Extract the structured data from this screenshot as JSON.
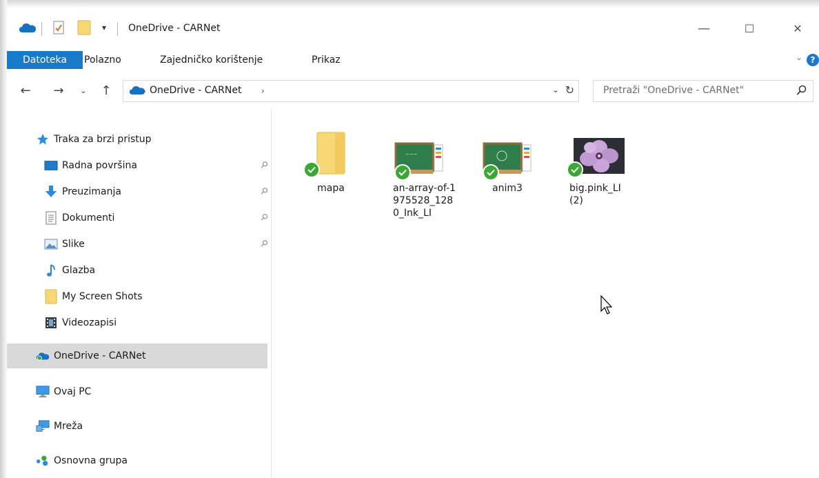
{
  "titlebar": {
    "title": "OneDrive - CARNet",
    "dropdown_glyph": "▾"
  },
  "window_controls": {
    "minimize": "—",
    "maximize": "☐",
    "close": "✕"
  },
  "ribbon": {
    "tabs": [
      "Datoteka",
      "Polazno",
      "Zajedničko korištenje",
      "Prikaz"
    ],
    "help": "?"
  },
  "address": {
    "path": [
      "OneDrive - CARNet"
    ],
    "search_placeholder": "Pretraži \"OneDrive - CARNet\""
  },
  "nav": {
    "quick_access": "Traka za brzi pristup",
    "quick_items": [
      {
        "label": "Radna površina",
        "icon": "desktop-icon",
        "pinned": true
      },
      {
        "label": "Preuzimanja",
        "icon": "downloads-icon",
        "pinned": true
      },
      {
        "label": "Dokumenti",
        "icon": "documents-icon",
        "pinned": true
      },
      {
        "label": "Slike",
        "icon": "pictures-icon",
        "pinned": true
      },
      {
        "label": "Glazba",
        "icon": "music-icon",
        "pinned": false
      },
      {
        "label": "My Screen Shots",
        "icon": "folder-icon",
        "pinned": false
      },
      {
        "label": "Videozapisi",
        "icon": "videos-icon",
        "pinned": false
      }
    ],
    "onedrive": "OneDrive - CARNet",
    "this_pc": "Ovaj PC",
    "network": "Mreža",
    "homegroup": "Osnovna grupa"
  },
  "files": [
    {
      "name": "mapa",
      "type": "folder",
      "status": "synced"
    },
    {
      "name": "an-array-of-1975528_1280_Ink_LI",
      "type": "ink-image",
      "status": "synced"
    },
    {
      "name": "anim3",
      "type": "ink-image",
      "status": "synced"
    },
    {
      "name": "big.pink_LI (2)",
      "type": "photo",
      "status": "synced"
    }
  ],
  "colors": {
    "accent": "#1979ca",
    "selected_nav": "#d9d9d9",
    "sync_green": "#3aa835",
    "folder_yellow": "#f8d775"
  }
}
